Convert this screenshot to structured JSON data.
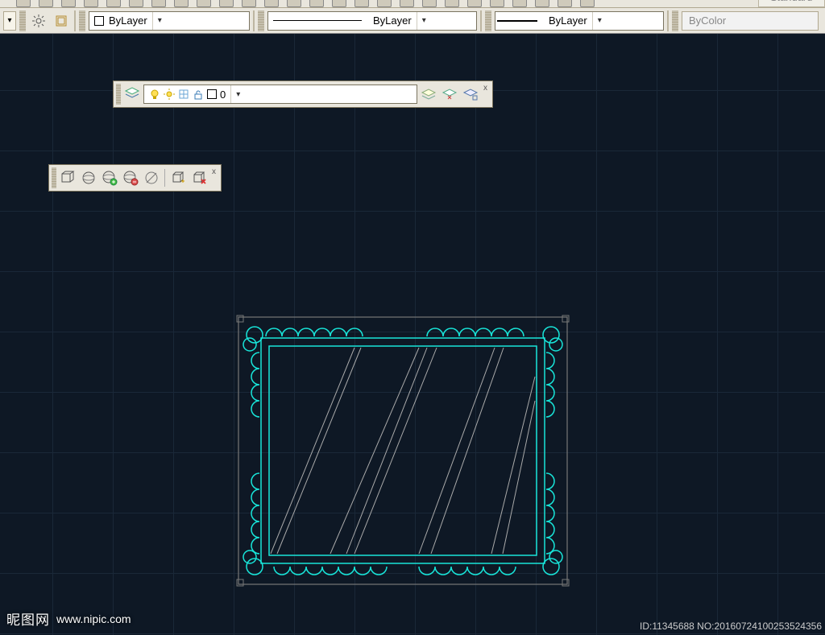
{
  "style_name": "Standard",
  "properties": {
    "color_label": "ByLayer",
    "linetype_label": "ByLayer",
    "lineweight_label": "ByLayer",
    "plotstyle_label": "ByColor"
  },
  "layer_toolbar": {
    "current_layer": "0",
    "close": "x"
  },
  "viewport_toolbar": {
    "close": "x"
  },
  "watermark": {
    "brand_ch": "昵图网",
    "brand_url": "www.nipic.com",
    "id_label": "ID:11345688 NO:20160724100253524356"
  }
}
